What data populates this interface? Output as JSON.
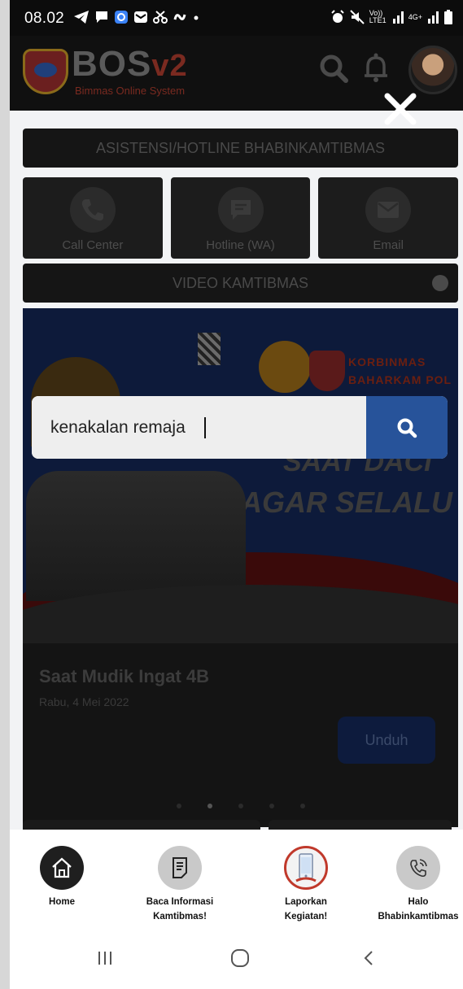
{
  "status_bar": {
    "time": "08.02",
    "left_icons": [
      "telegram-icon",
      "chat-icon",
      "o-app-icon",
      "mail-box-icon",
      "scissors-icon",
      "s-app-icon",
      "dot-icon"
    ],
    "right_icons": [
      "alarm-icon",
      "mute-icon",
      "volte-icon",
      "signal-icon",
      "4g-icon",
      "signal-icon",
      "battery-icon"
    ],
    "volte_label": "Vo)) LTE1",
    "net_label": "4G+"
  },
  "header": {
    "brand": "BOS",
    "brand_suffix": "v2",
    "brand_subtitle": "Bimmas Online System"
  },
  "overlay": {
    "search_value": "kenakalan remaja",
    "close_icon": "close-icon",
    "search_icon": "search-icon"
  },
  "main": {
    "assist_title": "ASISTENSI/HOTLINE BHABINKAMTIBMAS",
    "contacts": [
      {
        "label": "Call Center",
        "icon": "phone-icon"
      },
      {
        "label": "Hotline (WA)",
        "icon": "message-icon"
      },
      {
        "label": "Email",
        "icon": "email-icon"
      }
    ],
    "video_title": "VIDEO KAMTIBMAS",
    "banner": {
      "org_line1": "KORBINMAS",
      "org_line2": "BAHARKAM POL",
      "headline1": "SAAT DACI",
      "headline2": "AGAR SELALU"
    },
    "post": {
      "title": "Saat Mudik Ingat 4B",
      "date": "Rabu, 4 Mei 2022",
      "download_label": "Unduh"
    },
    "carousel_dots": 5,
    "carousel_active": 2
  },
  "bottom_nav": {
    "items": [
      {
        "label": "Home",
        "icon": "home-icon"
      },
      {
        "label": "Baca Informasi Kamtibmas!",
        "line1": "Baca Informasi",
        "line2": "Kamtibmas!",
        "icon": "document-icon"
      },
      {
        "label": "Laporkan Kegiatan!",
        "line1": "Laporkan",
        "line2": "Kegiatan!",
        "icon": "phone-report-icon"
      },
      {
        "label": "Halo Bhabinkamtibmas",
        "line1": "Halo",
        "line2": "Bhabinkamtibmas",
        "icon": "phone-call-icon"
      }
    ]
  },
  "android_nav": [
    "recents-icon",
    "home-circle-icon",
    "back-icon"
  ],
  "colors": {
    "search_button": "#27539a",
    "home_active": "#1f1f1f",
    "overlay_dim": "#000000"
  }
}
